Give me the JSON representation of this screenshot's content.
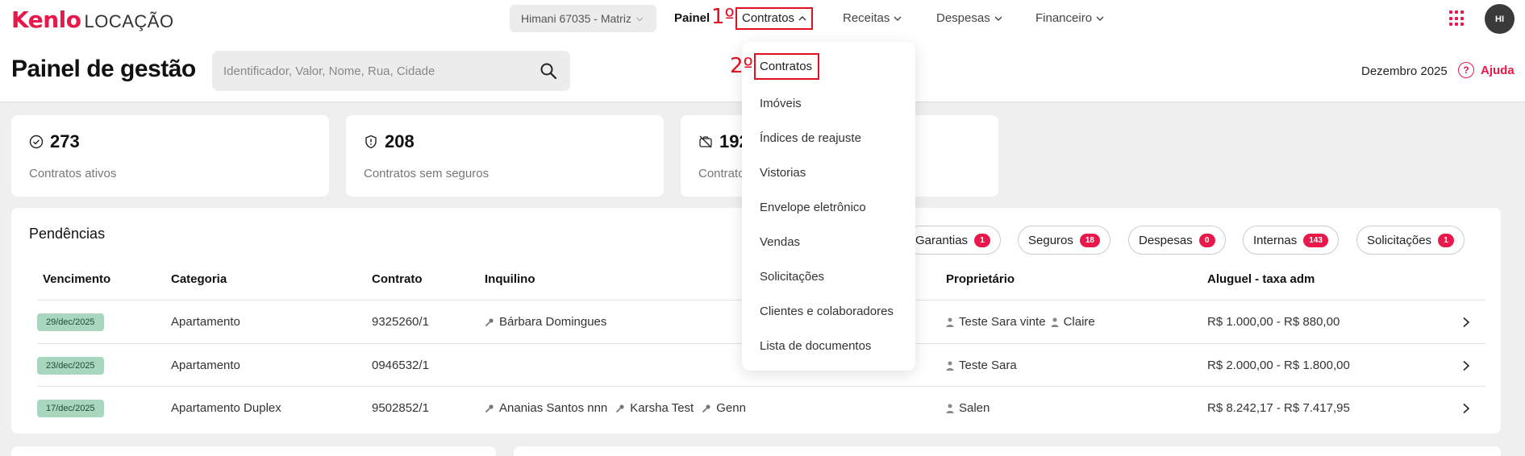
{
  "brand": {
    "logo_main": "Kenlo",
    "logo_sub": "LOCAÇÃO",
    "accent": "#e8194a",
    "annotation_color": "#e10f1f"
  },
  "topnav": {
    "branch": "Himani 67035 - Matriz",
    "items": [
      {
        "label": "Painel"
      },
      {
        "label": "Contratos"
      },
      {
        "label": "Receitas"
      },
      {
        "label": "Despesas"
      },
      {
        "label": "Financeiro"
      }
    ],
    "avatar": "HI"
  },
  "annotations": {
    "step1": "1º",
    "step2": "2º"
  },
  "header": {
    "title": "Painel de gestão",
    "search_placeholder": "Identificador, Valor, Nome, Rua, Cidade",
    "month": "Dezembro 2025",
    "help": "Ajuda"
  },
  "stats": [
    {
      "value": "273",
      "label": "Contratos ativos",
      "icon": "check-circle-icon"
    },
    {
      "value": "208",
      "label": "Contratos sem seguros",
      "icon": "shield-icon"
    },
    {
      "value": "192",
      "label": "Contratos",
      "icon": "camera-off-icon"
    }
  ],
  "pendencias": {
    "title": "Pendências",
    "chips": [
      {
        "label": "Garantias",
        "count": "1"
      },
      {
        "label": "Seguros",
        "count": "18"
      },
      {
        "label": "Despesas",
        "count": "0"
      },
      {
        "label": "Internas",
        "count": "143"
      },
      {
        "label": "Solicitações",
        "count": "1"
      }
    ],
    "columns": [
      "Vencimento",
      "Categoria",
      "Contrato",
      "Inquilino",
      "Proprietário",
      "Aluguel - taxa adm"
    ],
    "rows": [
      {
        "vencimento": "29/dec/2025",
        "categoria": "Apartamento",
        "contrato": "9325260/1",
        "inquilinos": [
          "Bárbara Domingues"
        ],
        "proprietarios": [
          "Teste Sara vinte",
          "Claire"
        ],
        "aluguel": "R$ 1.000,00 - R$ 880,00"
      },
      {
        "vencimento": "23/dec/2025",
        "categoria": "Apartamento",
        "contrato": "0946532/1",
        "inquilinos": [],
        "proprietarios": [
          "Teste Sara"
        ],
        "aluguel": "R$ 2.000,00 - R$ 1.800,00"
      },
      {
        "vencimento": "17/dec/2025",
        "categoria": "Apartamento Duplex",
        "contrato": "9502852/1",
        "inquilinos": [
          "Ananias Santos nnn",
          "Karsha Test",
          "Genn"
        ],
        "proprietarios": [
          "Salen"
        ],
        "aluguel": "R$ 8.242,17 - R$ 7.417,95"
      }
    ]
  },
  "dropdown": {
    "items": [
      "Contratos",
      "Imóveis",
      "Índices de reajuste",
      "Vistorias",
      "Envelope eletrônico",
      "Vendas",
      "Solicitações",
      "Clientes e colaboradores",
      "Lista de documentos"
    ]
  }
}
